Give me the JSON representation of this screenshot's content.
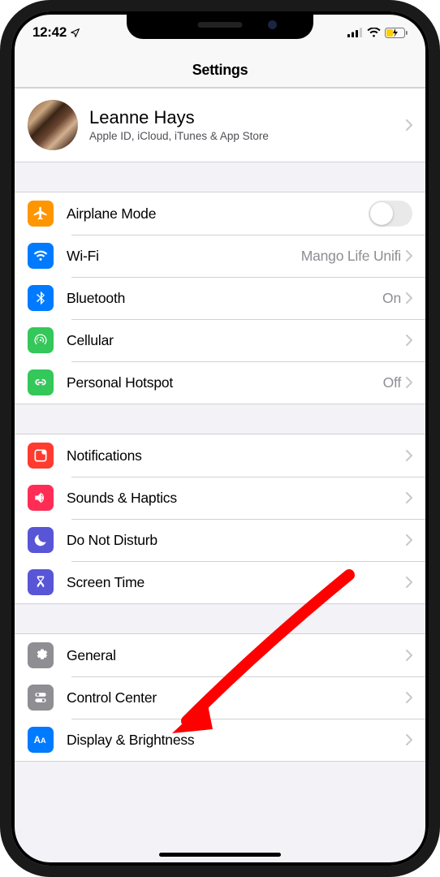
{
  "status": {
    "time": "12:42"
  },
  "header": {
    "title": "Settings"
  },
  "account": {
    "name": "Leanne Hays",
    "subtitle": "Apple ID, iCloud, iTunes & App Store"
  },
  "group1": {
    "airplane": {
      "label": "Airplane Mode",
      "on": false
    },
    "wifi": {
      "label": "Wi-Fi",
      "value": "Mango Life Unifi"
    },
    "bluetooth": {
      "label": "Bluetooth",
      "value": "On"
    },
    "cellular": {
      "label": "Cellular"
    },
    "hotspot": {
      "label": "Personal Hotspot",
      "value": "Off"
    }
  },
  "group2": {
    "notifications": {
      "label": "Notifications"
    },
    "sounds": {
      "label": "Sounds & Haptics"
    },
    "dnd": {
      "label": "Do Not Disturb"
    },
    "screentime": {
      "label": "Screen Time"
    }
  },
  "group3": {
    "general": {
      "label": "General"
    },
    "controlcenter": {
      "label": "Control Center"
    },
    "display": {
      "label": "Display & Brightness"
    }
  },
  "colors": {
    "orange": "#ff9500",
    "blue": "#007aff",
    "green": "#34c759",
    "red": "#ff3b30",
    "indigo": "#5856d6",
    "gray": "#8e8e93",
    "pink": "#ff2d55"
  }
}
